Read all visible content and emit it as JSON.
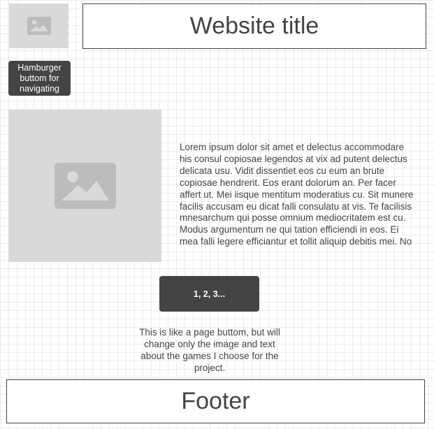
{
  "header": {
    "logo_icon": "image-placeholder-icon",
    "title": "Website title"
  },
  "nav": {
    "hamburger_label": "Hamburger buttom for navigating"
  },
  "content": {
    "image_icon": "image-placeholder-icon",
    "body_text": "Lorem ipsum dolor sit amet et delectus accommodare his consul copiosae legendos at vix ad putent delectus delicata usu. Vidit dissentiet eos cu eum an brute copiosae hendrerit. Eos erant dolorum an. Per facer affert ut. Mei iisque mentitum moderatius cu. Sit munere facilis accusam eu dicat falli consulatu at vis. Te facilisis mnesarchum qui posse omnium mediocritatem est cu. Modus argumentum ne qui tation efficiendi in eos. Ei mea falli legere efficiantur et tollit aliquip debitis mei. No"
  },
  "pagination": {
    "button_label": "1, 2, 3...",
    "note": "This is like a page buttom, but will change only the image and text about the games I choose for the project."
  },
  "footer": {
    "label": "Footer"
  },
  "colors": {
    "dark_button": "#444444",
    "placeholder_bg": "#d9d9d9",
    "placeholder_icon": "#bcbcbc",
    "grid_line": "#ececec"
  }
}
